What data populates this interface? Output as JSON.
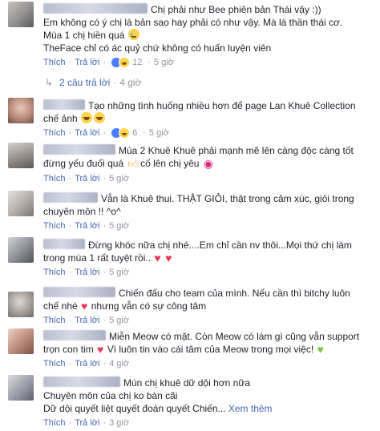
{
  "actions": {
    "like": "Thích",
    "reply": "Trả lời",
    "separator": "·"
  },
  "comments": [
    {
      "lines": [
        "Chị phải như Bee phiên bản Thái vậy :))",
        "Em không có ý chị là bản sao hay phải có như vậy. Mà là thần thái cơ.",
        "Mùa 1 chị hiền quá",
        "TheFace chỉ có ác quỷ chứ không có huấn luyện viên"
      ],
      "reaction_count": "12",
      "time": "5 giờ"
    },
    {
      "lines": [
        "Tạo những tình huống nhiều hơn để page Lan Khuê Collection",
        "chế ảnh"
      ],
      "reaction_count": "6",
      "time": "5 giờ"
    },
    {
      "lines": [
        "Mùa 2 Khuê Khuê phải mạnh mẽ lên càng độc càng tốt",
        "đừng yếu đuối quá",
        "cố lên chị yêu"
      ],
      "time": "5 giờ"
    },
    {
      "lines": [
        "Vẫn là Khuê thui. THẬT GIỎI, thật trong cảm xúc, giỏi trong",
        "chuyên môn !! ^o^"
      ],
      "time": "5 giờ"
    },
    {
      "lines": [
        "Đừng khóc nữa chị nhé....Em chỉ cần nv thôi...Mọi thứ chị làm",
        "trong mùa 1 rất tuyệt rồi.."
      ],
      "time": "5 giờ"
    },
    {
      "lines": [
        "Chiến đấu cho team của mình. Nếu cần thì bitchy luôn",
        "chế nhé",
        "nhưng vẫn có sự công tâm"
      ],
      "time": "5 giờ"
    },
    {
      "lines": [
        "Miễn Meow có mặt. Còn Meow có làm gì cũng vẫn support",
        "trọn con tim",
        "Vì luôn tin vào cái tâm của Meow trong mọi việc!"
      ],
      "time": "4 giờ"
    },
    {
      "lines": [
        "Mún chị khuê dữ dội hơn nữa",
        "Chuyên môn của chị ko bàn cãi",
        "Dữ dội quyết liệt quyết đoán quyết Chiến..."
      ],
      "see_more": "Xem thêm",
      "time": "3 giờ"
    }
  ],
  "replies": {
    "label": "2 câu trả lời",
    "time": "4 giờ"
  },
  "colors": {
    "link": "#4267b2",
    "meta": "#90949c",
    "text": "#1d2129",
    "like_blue": "#4c7cff",
    "heart": "#e8385b"
  },
  "icons": [
    "cry-emoji-icon",
    "laugh-emoji-icon",
    "thumbs-up-emoji-icon",
    "kiss-lips-emoji-icon",
    "red-heart-icon",
    "green-heart-icon",
    "like-reaction-icon",
    "haha-reaction-icon",
    "reply-arrow-icon"
  ]
}
